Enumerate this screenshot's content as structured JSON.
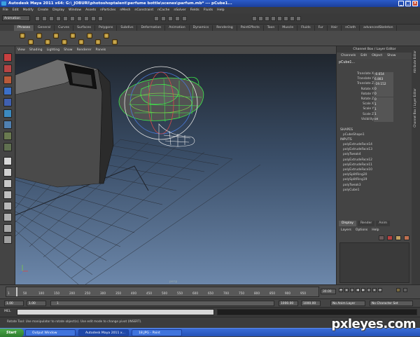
{
  "window": {
    "title": "Autodesk Maya 2011 x64: G:\\_JOBURI\\photoshoptalent\\perfume bottle\\scenes\\parfum.mb* --- pCube1...",
    "controls": [
      "_",
      "□",
      "×"
    ]
  },
  "menubar": [
    "File",
    "Edit",
    "Modify",
    "Create",
    "Display",
    "Window",
    "Assets",
    "nParticles",
    "nMesh",
    "nConstraint",
    "nCache",
    "nSolver",
    "Fields",
    "Fluids",
    "Help"
  ],
  "statusline": {
    "mode": "Animation"
  },
  "shelf_tabs": [
    "Phrases",
    "General",
    "Curves",
    "Surfaces",
    "Polygons",
    "Subdivs",
    "Deformation",
    "Animation",
    "Dynamics",
    "Rendering",
    "PaintEffects",
    "Toon",
    "Muscle",
    "Fluids",
    "Fur",
    "Hair",
    "nCloth",
    "advancedSkeleton"
  ],
  "panel_menu": [
    "View",
    "Shading",
    "Lighting",
    "Show",
    "Renderer",
    "Panels"
  ],
  "viewport": {
    "camera_label": "persp"
  },
  "channel_box": {
    "title": "Channel Box / Layer Editor",
    "menu": [
      "Channels",
      "Edit",
      "Object",
      "Show"
    ],
    "object_name": "pCube1...",
    "attributes": [
      {
        "label": "Translate X",
        "value": "-0.654"
      },
      {
        "label": "Translate Y",
        "value": "6.883"
      },
      {
        "label": "Translate Z",
        "value": "-19.152"
      },
      {
        "label": "Rotate X",
        "value": "0"
      },
      {
        "label": "Rotate Y",
        "value": "0"
      },
      {
        "label": "Rotate Z",
        "value": "0"
      },
      {
        "label": "Scale X",
        "value": "1"
      },
      {
        "label": "Scale Y",
        "value": "1"
      },
      {
        "label": "Scale Z",
        "value": "1"
      },
      {
        "label": "Visibility",
        "value": "on"
      }
    ],
    "shapes_label": "SHAPES",
    "shape_name": "pCubeShape1",
    "inputs_label": "INPUTS",
    "inputs": [
      "polyExtrudeFace14",
      "polyExtrudeFace13",
      "polyTweak4",
      "polyExtrudeFace12",
      "polyExtrudeFace11",
      "polyExtrudeFace10",
      "polySplitRing20",
      "polySplitRing19",
      "polyTweak3",
      "polyCube1"
    ]
  },
  "layer_editor": {
    "tabs": [
      "Display",
      "Render",
      "Anim"
    ],
    "active_tab": "Display",
    "menu": [
      "Layers",
      "Options",
      "Help"
    ]
  },
  "side_tabs": [
    "Attribute Editor",
    "Channel Box / Layer Editor"
  ],
  "timeline": {
    "ticks": [
      "1",
      "50",
      "100",
      "150",
      "200",
      "250",
      "300",
      "350",
      "400",
      "450",
      "500",
      "550",
      "600",
      "650",
      "700",
      "750",
      "800",
      "850",
      "900",
      "950"
    ],
    "current_frame": "30.00"
  },
  "range": {
    "start": "1.00",
    "start_playback": "1.00",
    "range_start": "1",
    "range_end": "1000",
    "end_playback": "1000.00",
    "end": "1000.00",
    "anim_layer": "No Anim Layer",
    "character_set": "No Character Set"
  },
  "command_line": {
    "label": "MEL"
  },
  "help_line": "Rotate Tool: Use manipulator to rotate object(s). Use edit mode to change pivot (INSERT).",
  "taskbar": {
    "start": "Start",
    "tasks": [
      {
        "label": "Output Window",
        "active": false
      },
      {
        "label": "Autodesk Maya 2011 x...",
        "active": true
      },
      {
        "label": "18.JPG - Paint",
        "active": false
      }
    ]
  },
  "watermark": "pxleyes.com",
  "colors": {
    "title_blue": "#2a5bc9",
    "selection_green": "#3cff4a",
    "maya_grey": "#444444"
  }
}
